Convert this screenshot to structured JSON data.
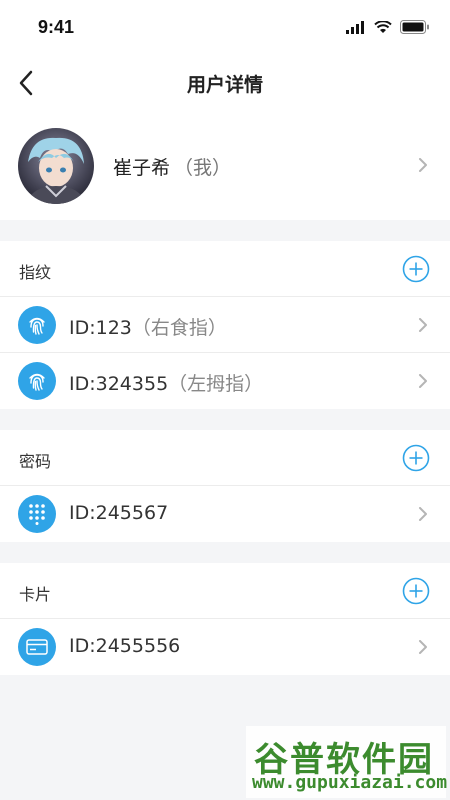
{
  "status_bar": {
    "time": "9:41"
  },
  "header": {
    "title": "用户详情"
  },
  "profile": {
    "name": "崔子希",
    "tag": "（我）"
  },
  "sections": [
    {
      "title": "指纹",
      "items": [
        {
          "id": "ID:123",
          "note": "（右食指）",
          "icon": "fingerprint-icon"
        },
        {
          "id": "ID:324355",
          "note": "（左拇指）",
          "icon": "fingerprint-icon"
        }
      ]
    },
    {
      "title": "密码",
      "items": [
        {
          "id": "ID:245567",
          "note": "",
          "icon": "keypad-icon"
        }
      ]
    },
    {
      "title": "卡片",
      "items": [
        {
          "id": "ID:2455556",
          "note": "",
          "icon": "card-icon"
        }
      ]
    }
  ],
  "watermark": {
    "top": "谷普软件园",
    "bottom": "www.gupuxiazai.com"
  },
  "colors": {
    "accent": "#2fa4e7",
    "background": "#f4f5f7"
  }
}
